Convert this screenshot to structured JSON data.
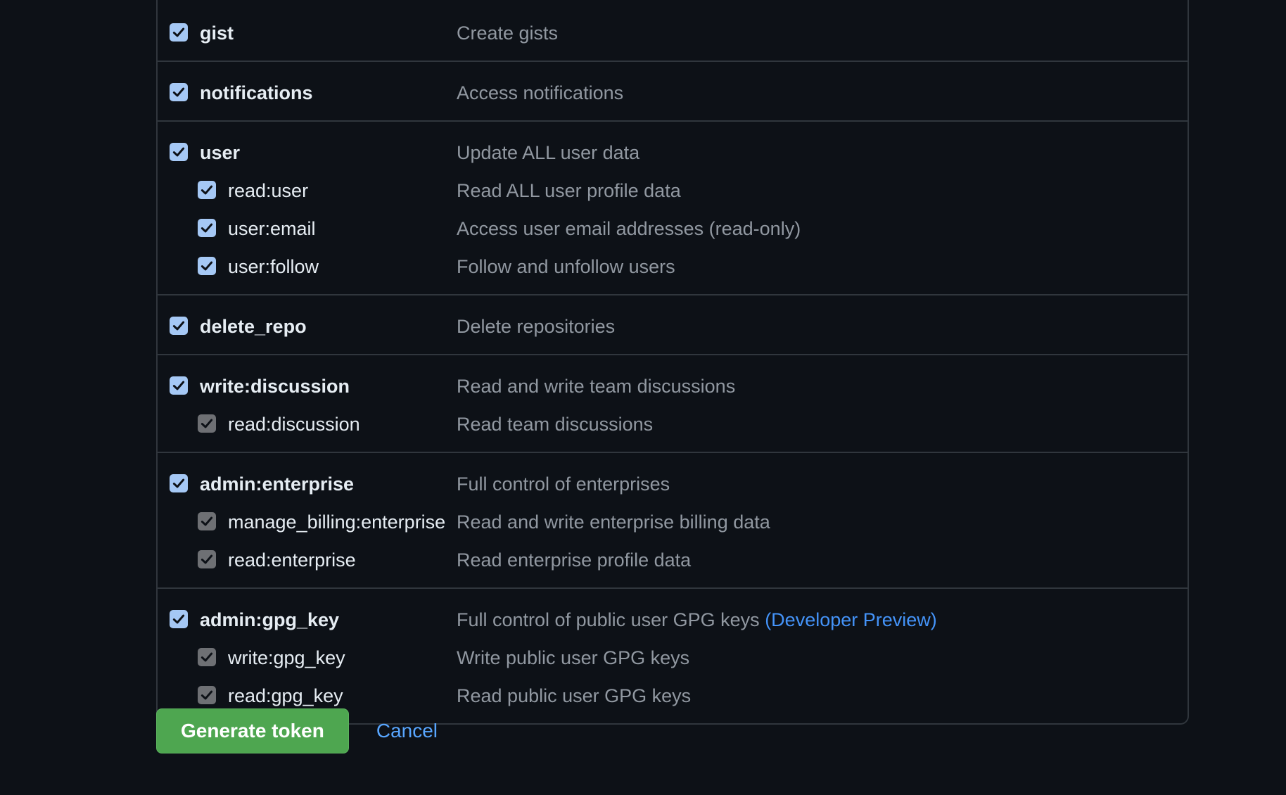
{
  "groups": [
    {
      "scopes": [
        {
          "name": "gist",
          "desc": "Create gists",
          "level": "top",
          "checked": "blue"
        }
      ]
    },
    {
      "scopes": [
        {
          "name": "notifications",
          "desc": "Access notifications",
          "level": "top",
          "checked": "blue"
        }
      ]
    },
    {
      "scopes": [
        {
          "name": "user",
          "desc": "Update ALL user data",
          "level": "top",
          "checked": "blue"
        },
        {
          "name": "read:user",
          "desc": "Read ALL user profile data",
          "level": "sub",
          "checked": "blue"
        },
        {
          "name": "user:email",
          "desc": "Access user email addresses (read-only)",
          "level": "sub",
          "checked": "blue"
        },
        {
          "name": "user:follow",
          "desc": "Follow and unfollow users",
          "level": "sub",
          "checked": "blue"
        }
      ]
    },
    {
      "scopes": [
        {
          "name": "delete_repo",
          "desc": "Delete repositories",
          "level": "top",
          "checked": "blue"
        }
      ]
    },
    {
      "scopes": [
        {
          "name": "write:discussion",
          "desc": "Read and write team discussions",
          "level": "top",
          "checked": "blue"
        },
        {
          "name": "read:discussion",
          "desc": "Read team discussions",
          "level": "sub",
          "checked": "gray"
        }
      ]
    },
    {
      "scopes": [
        {
          "name": "admin:enterprise",
          "desc": "Full control of enterprises",
          "level": "top",
          "checked": "blue"
        },
        {
          "name": "manage_billing:enterprise",
          "desc": "Read and write enterprise billing data",
          "level": "sub",
          "checked": "gray"
        },
        {
          "name": "read:enterprise",
          "desc": "Read enterprise profile data",
          "level": "sub",
          "checked": "gray"
        }
      ]
    },
    {
      "scopes": [
        {
          "name": "admin:gpg_key",
          "desc": "Full control of public user GPG keys",
          "desc_link": "(Developer Preview)",
          "level": "top",
          "checked": "blue"
        },
        {
          "name": "write:gpg_key",
          "desc": "Write public user GPG keys",
          "level": "sub",
          "checked": "gray"
        },
        {
          "name": "read:gpg_key",
          "desc": "Read public user GPG keys",
          "level": "sub",
          "checked": "gray"
        }
      ]
    }
  ],
  "actions": {
    "generate_label": "Generate token",
    "cancel_label": "Cancel"
  },
  "colors": {
    "background": "#0d1117",
    "border": "#30363d",
    "checkbox_active": "#a5c8f5",
    "checkbox_disabled": "#6e7074",
    "primary_button": "#4ea650",
    "link": "#58a6ff"
  },
  "icons": {
    "checkbox": "checkmark-icon"
  }
}
